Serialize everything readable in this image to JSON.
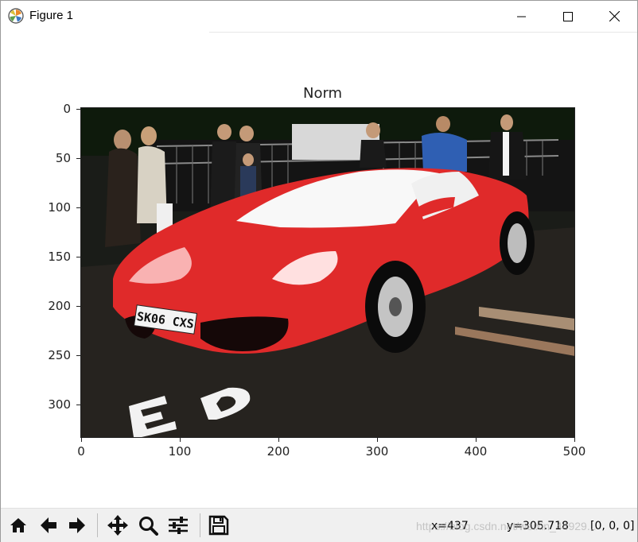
{
  "window": {
    "title": "Figure 1"
  },
  "figure": {
    "axes_title": "Norm",
    "y_ticks": [
      "0",
      "50",
      "100",
      "150",
      "200",
      "250",
      "300"
    ],
    "x_ticks": [
      "0",
      "100",
      "200",
      "300",
      "400",
      "500"
    ],
    "image": {
      "plate_text": "SK06 CXS",
      "road_marking": "E D"
    }
  },
  "toolbar": {
    "home_icon": "home-icon",
    "back_icon": "arrow-left-icon",
    "forward_icon": "arrow-right-icon",
    "pan_icon": "move-icon",
    "zoom_icon": "magnifier-icon",
    "configure_icon": "sliders-icon",
    "save_icon": "floppy-icon",
    "x_readout": "x=437",
    "y_readout": "y=305.718",
    "pixel_value": "[0, 0, 0]"
  },
  "watermark": "https://blog.csdn.net/weixin_44929..."
}
